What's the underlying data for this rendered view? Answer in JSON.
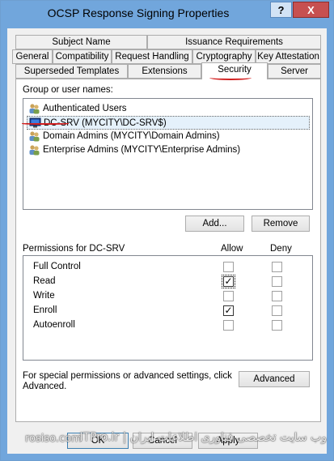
{
  "window": {
    "title": "OCSP Response Signing Properties",
    "help_label": "?",
    "close_label": "X"
  },
  "tabs": {
    "row1": [
      "Subject Name",
      "Issuance Requirements"
    ],
    "row2": [
      "General",
      "Compatibility",
      "Request Handling",
      "Cryptography",
      "Key Attestation"
    ],
    "row3": [
      "Superseded Templates",
      "Extensions",
      "Security",
      "Server"
    ],
    "active": "Security"
  },
  "security": {
    "group_label": "Group or user names:",
    "users": [
      {
        "name": "Authenticated Users",
        "icon": "users-icon",
        "selected": false
      },
      {
        "name": "DC-SRV (MYCITY\\DC-SRV$)",
        "icon": "computer-icon",
        "selected": true
      },
      {
        "name": "Domain Admins (MYCITY\\Domain Admins)",
        "icon": "users-icon",
        "selected": false
      },
      {
        "name": "Enterprise Admins (MYCITY\\Enterprise Admins)",
        "icon": "users-icon",
        "selected": false
      }
    ],
    "add_label": "Add...",
    "remove_label": "Remove",
    "permissions_label": "Permissions for DC-SRV",
    "allow_label": "Allow",
    "deny_label": "Deny",
    "permissions": [
      {
        "name": "Full Control",
        "allow": false,
        "deny": false
      },
      {
        "name": "Read",
        "allow": true,
        "deny": false
      },
      {
        "name": "Write",
        "allow": false,
        "deny": false
      },
      {
        "name": "Enroll",
        "allow": true,
        "deny": false
      },
      {
        "name": "Autoenroll",
        "allow": false,
        "deny": false
      }
    ],
    "special_text_1": "For special permissions or advanced settings, click",
    "special_text_2": "Advanced.",
    "advanced_label": "Advanced"
  },
  "footer": {
    "ok_label": "OK",
    "cancel_label": "Cancel",
    "apply_label": "Apply"
  },
  "watermark": {
    "left": "rosiso.com",
    "right": "ITPro.ir | وب سایت تخصصی فناوری اطلاعات ایران"
  }
}
